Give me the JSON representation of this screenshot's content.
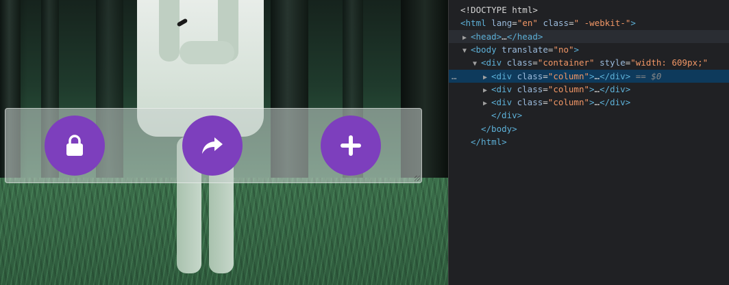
{
  "preview": {
    "buttons": [
      {
        "label": "lock",
        "icon": "lock-icon"
      },
      {
        "label": "share",
        "icon": "share-icon"
      },
      {
        "label": "add",
        "icon": "plus-icon"
      }
    ],
    "accent": "#7d3fbd"
  },
  "devtools": {
    "lines": [
      {
        "indent": 0,
        "t": "",
        "parts": [
          [
            "txt",
            "<!DOCTYPE html>"
          ]
        ]
      },
      {
        "indent": 0,
        "t": "",
        "parts": [
          [
            "tag",
            "<html"
          ],
          [
            "attr",
            " lang"
          ],
          [
            "txt",
            "="
          ],
          [
            "val",
            "\"en\""
          ],
          [
            "attr",
            " class"
          ],
          [
            "txt",
            "="
          ],
          [
            "val",
            "\" -webkit-\""
          ],
          [
            "tag",
            ">"
          ]
        ]
      },
      {
        "indent": 1,
        "t": "▶",
        "parts": [
          [
            "tag",
            "<head>"
          ],
          [
            "txt",
            "…"
          ],
          [
            "tag",
            "</head>"
          ]
        ]
      },
      {
        "indent": 1,
        "t": "▼",
        "parts": [
          [
            "tag",
            "<body"
          ],
          [
            "attr",
            " translate"
          ],
          [
            "txt",
            "="
          ],
          [
            "val",
            "\"no\""
          ],
          [
            "tag",
            ">"
          ]
        ]
      },
      {
        "indent": 2,
        "t": "▼",
        "parts": [
          [
            "tag",
            "<div"
          ],
          [
            "attr",
            " class"
          ],
          [
            "txt",
            "="
          ],
          [
            "val",
            "\"container\""
          ],
          [
            "attr",
            " style"
          ],
          [
            "txt",
            "="
          ],
          [
            "val",
            "\"width: 609px;\""
          ]
        ]
      },
      {
        "indent": 3,
        "t": "▶",
        "parts": [
          [
            "tag",
            "<div"
          ],
          [
            "attr",
            " class"
          ],
          [
            "txt",
            "="
          ],
          [
            "val",
            "\"column\""
          ],
          [
            "tag",
            ">"
          ],
          [
            "txt",
            "…"
          ],
          [
            "tag",
            "</div>"
          ],
          [
            "cmt",
            " == $0"
          ]
        ]
      },
      {
        "indent": 3,
        "t": "▶",
        "parts": [
          [
            "tag",
            "<div"
          ],
          [
            "attr",
            " class"
          ],
          [
            "txt",
            "="
          ],
          [
            "val",
            "\"column\""
          ],
          [
            "tag",
            ">"
          ],
          [
            "txt",
            "…"
          ],
          [
            "tag",
            "</div>"
          ]
        ]
      },
      {
        "indent": 3,
        "t": "▶",
        "parts": [
          [
            "tag",
            "<div"
          ],
          [
            "attr",
            " class"
          ],
          [
            "txt",
            "="
          ],
          [
            "val",
            "\"column\""
          ],
          [
            "tag",
            ">"
          ],
          [
            "txt",
            "…"
          ],
          [
            "tag",
            "</div>"
          ]
        ]
      },
      {
        "indent": 3,
        "t": "",
        "parts": [
          [
            "tag",
            "</div>"
          ]
        ]
      },
      {
        "indent": 2,
        "t": "",
        "parts": [
          [
            "tag",
            "</body>"
          ]
        ]
      },
      {
        "indent": 1,
        "t": "",
        "parts": [
          [
            "tag",
            "</html>"
          ]
        ]
      }
    ],
    "selected_index": 5,
    "hover_index": 2,
    "gutter_dots": "…"
  }
}
